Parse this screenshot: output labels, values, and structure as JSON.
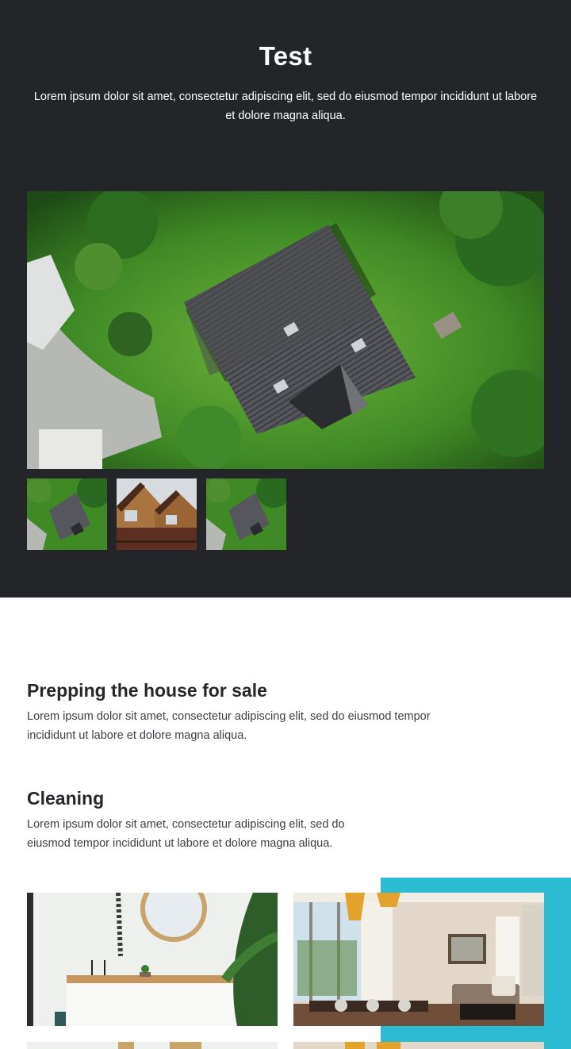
{
  "hero": {
    "title": "Test",
    "description": "Lorem ipsum dolor sit amet, consectetur adipiscing elit, sed do eiusmod tempor incididunt ut labore et dolore magna aliqua."
  },
  "gallery": {
    "main_image": "aerial-house-photo",
    "thumbnails": [
      "aerial-house-thumbnail",
      "wooden-house-thumbnail",
      "aerial-house-thumbnail"
    ]
  },
  "sections": [
    {
      "title": "Prepping the house for sale",
      "text": "Lorem ipsum dolor sit amet, consectetur adipiscing elit, sed do eiusmod tempor incididunt ut labore et dolore magna aliqua."
    },
    {
      "title": "Cleaning",
      "text": "Lorem ipsum dolor sit amet, consectetur adipiscing elit, sed do eiusmod tempor incididunt ut labore et dolore magna aliqua."
    }
  ],
  "colors": {
    "hero_background": "#232529",
    "accent": "#2bbcd4",
    "text_dark": "#25272b"
  }
}
